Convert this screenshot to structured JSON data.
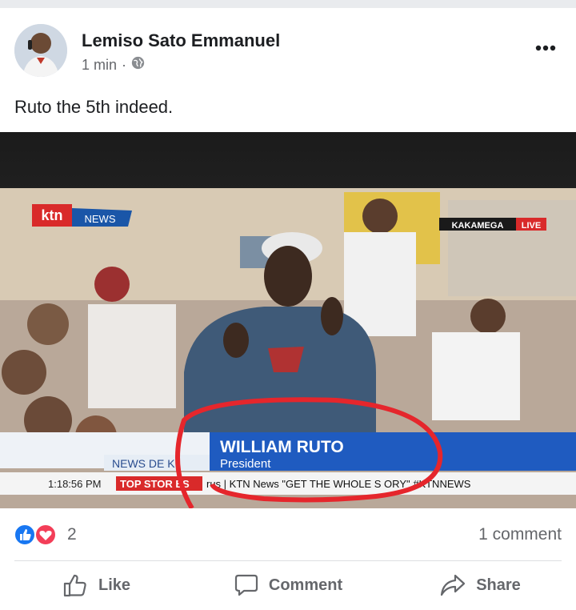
{
  "post": {
    "author_name": "Lemiso Sato Emmanuel",
    "timestamp": "1 min",
    "separator": "·",
    "privacy_icon": "globe-icon",
    "menu_icon": "more-dots-icon",
    "text": "Ruto the 5th indeed."
  },
  "media": {
    "channel_logo": "ktn",
    "channel_sub": "NEWS",
    "location_label": "KAKAMEGA",
    "live_label": "LIVE",
    "lower_third_name": "WILLIAM RUTO",
    "lower_third_title": "President",
    "news_desk_label": "NEWS DE K",
    "ticker_time": "1:18:56 PM",
    "ticker_badge": "TOP STOR ES",
    "ticker_text": "rus | KTN News \"GET THE WHOLE S ORY\" #KTNNEWS",
    "highlight_color": "#e5262c"
  },
  "reactions": {
    "icons": [
      "like-reaction-icon",
      "love-reaction-icon"
    ],
    "count": "2",
    "comments": "1 comment"
  },
  "actions": {
    "like": "Like",
    "comment": "Comment",
    "share": "Share"
  },
  "colors": {
    "like_blue": "#1877f2",
    "love_red": "#f33e58",
    "muted": "#65676b"
  }
}
